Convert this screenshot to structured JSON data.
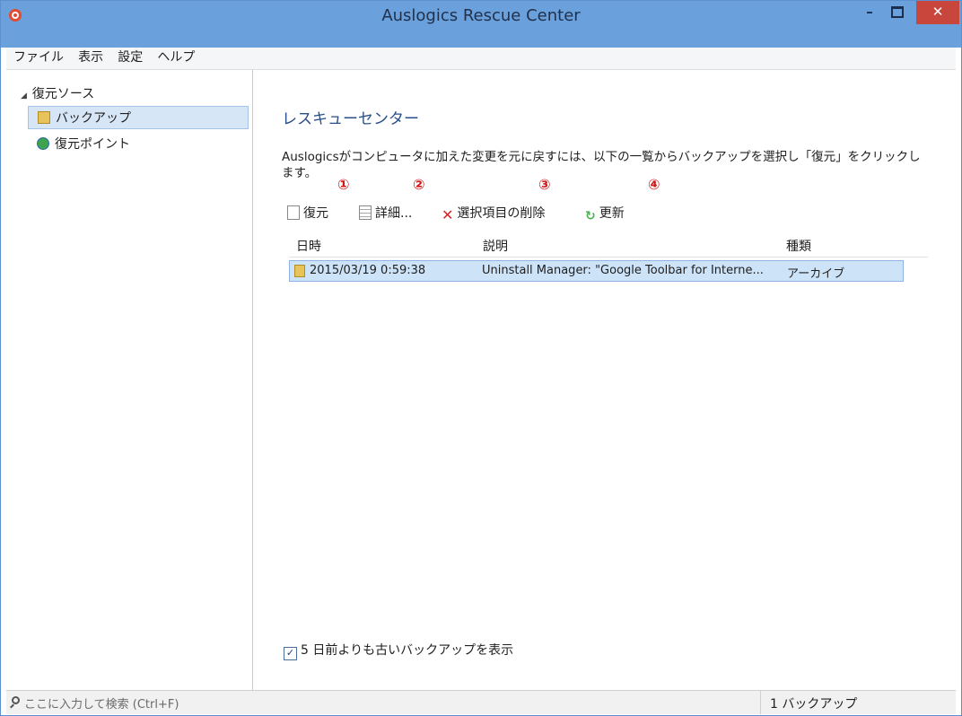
{
  "window": {
    "title": "Auslogics Rescue Center",
    "min_label": "–",
    "close_label": "✕"
  },
  "menu": [
    "ファイル",
    "表示",
    "設定",
    "ヘルプ"
  ],
  "sidebar": {
    "root_label": "復元ソース",
    "items": [
      {
        "label": "バックアップ",
        "icon": "folder-icon",
        "selected": true
      },
      {
        "label": "復元ポイント",
        "icon": "restore-point-icon",
        "selected": false
      }
    ]
  },
  "main": {
    "heading": "レスキューセンター",
    "description": "Auslogicsがコンピュータに加えた変更を元に戻すには、以下の一覧からバックアップを選択し「復元」をクリックします。",
    "markers": [
      "①",
      "②",
      "③",
      "④"
    ],
    "toolbar": {
      "restore": "復元",
      "details": "詳細...",
      "delete": "選択項目の削除",
      "refresh": "更新"
    },
    "table": {
      "headers": [
        "日時",
        "説明",
        "種類"
      ],
      "rows": [
        {
          "datetime": "2015/03/19 0:59:38",
          "description": "Uninstall Manager: \"Google Toolbar for Interne...",
          "type": "アーカイブ"
        }
      ]
    },
    "show_old": {
      "checked": true,
      "label": "5 日前よりも古いバックアップを表示"
    }
  },
  "statusbar": {
    "search_placeholder": "ここに入力して検索 (Ctrl+F)",
    "count": "1 バックアップ"
  },
  "colors": {
    "titlebar": "#6aa0dc",
    "close": "#c9463d",
    "selection": "#cde3f8",
    "heading": "#2a4f86",
    "marker": "#d01818"
  }
}
